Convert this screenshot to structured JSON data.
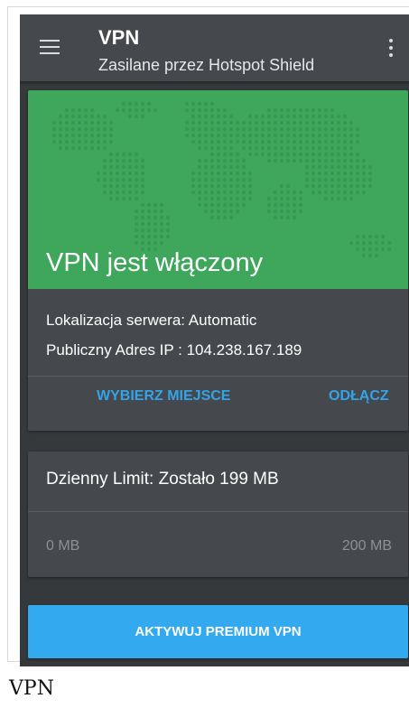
{
  "app_bar": {
    "title": "VPN",
    "subtitle": "Zasilane przez Hotspot Shield",
    "menu_icon": "hamburger-menu-icon",
    "more_icon": "more-vertical-icon"
  },
  "status_card": {
    "status_text": "VPN jest włączony",
    "server_location": "Lokalizacja serwera: Automatic",
    "public_ip": "Publiczny Adres IP : 104.238.167.189",
    "choose_location_label": "WYBIERZ MIEJSCE",
    "disconnect_label": "ODŁĄCZ",
    "map_color": "#3ea75c"
  },
  "limit_card": {
    "limit_text": "Dzienny Limit: Zostało 199 MB",
    "range_min": "0 MB",
    "range_max": "200 MB"
  },
  "premium_button": {
    "label": "AKTYWUJ PREMIUM VPN",
    "color": "#33a9f0"
  },
  "caption": "VPN",
  "colors": {
    "accent": "#33a4e8",
    "appbar": "#45484c",
    "background": "#36393c"
  }
}
